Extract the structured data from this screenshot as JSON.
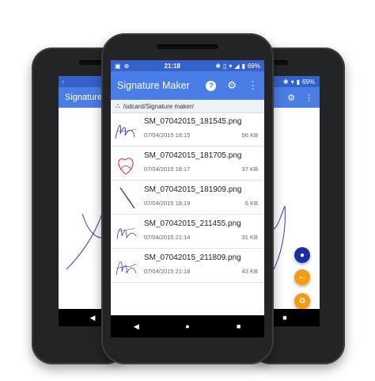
{
  "center": {
    "status": {
      "time": "21:18",
      "battery": "69%"
    },
    "appbar": {
      "title": "Signature Maker",
      "help_icon": "help-icon",
      "settings_icon": "gear-icon",
      "menu_icon": "more-vert-icon"
    },
    "breadcrumb": {
      "icon": "folder-tree-icon",
      "path": "/sdcard/Signature maker/"
    },
    "files": [
      {
        "name": "SM_07042015_181545.png",
        "date": "07/04/2015 18:15",
        "size": "56 KB"
      },
      {
        "name": "SM_07042015_181705.png",
        "date": "07/04/2015 18:17",
        "size": "37 KB"
      },
      {
        "name": "SM_07042015_181909.png",
        "date": "07/04/2015 18:19",
        "size": "6 KB"
      },
      {
        "name": "SM_07042015_211455.png",
        "date": "07/04/2015 21:14",
        "size": "31 KB"
      },
      {
        "name": "SM_07042015_211809.png",
        "date": "07/04/2015 21:18",
        "size": "43 KB"
      }
    ]
  },
  "left": {
    "appbar": {
      "title": "Signature M"
    }
  },
  "right": {
    "status": {
      "battery": "69%"
    }
  },
  "colors": {
    "status_bar": "#3562c9",
    "app_bar": "#4a7ee6",
    "fab_palette": "#1a2fa0",
    "fab_orange": "#f39c12",
    "fab_close": "#e53935",
    "fab_cloud": "#2aa7e8"
  }
}
